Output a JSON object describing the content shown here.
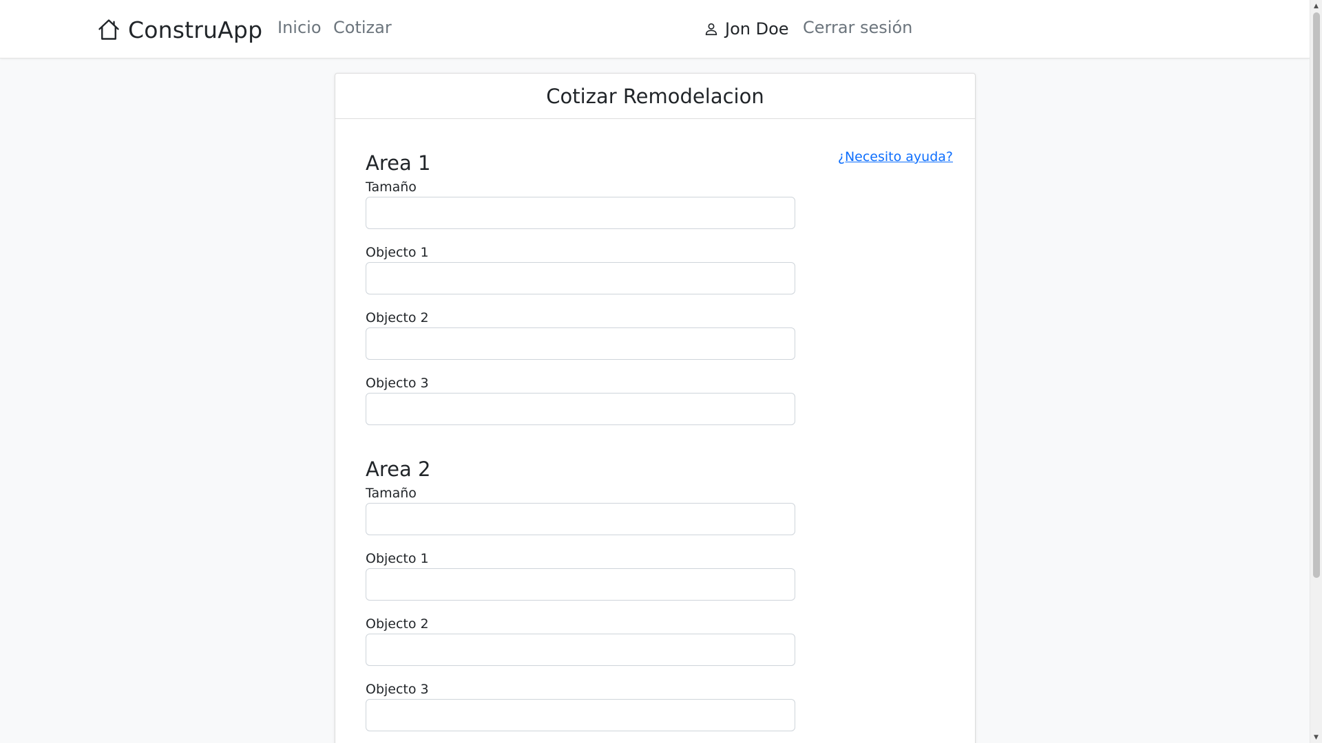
{
  "navbar": {
    "brand": "ConstruApp",
    "brand_icon": "house-icon",
    "links": [
      "Inicio",
      "Cotizar"
    ],
    "user_name": "Jon Doe",
    "user_icon": "person-icon",
    "logout": "Cerrar sesión"
  },
  "card": {
    "title": "Cotizar Remodelacion",
    "help_link": "¿Necesito ayuda?"
  },
  "areas": [
    {
      "title": "Area 1",
      "fields": [
        {
          "label": "Tamaño",
          "value": ""
        },
        {
          "label": "Objecto 1",
          "value": ""
        },
        {
          "label": "Objecto 2",
          "value": ""
        },
        {
          "label": "Objecto 3",
          "value": ""
        }
      ]
    },
    {
      "title": "Area 2",
      "fields": [
        {
          "label": "Tamaño",
          "value": ""
        },
        {
          "label": "Objecto 1",
          "value": ""
        },
        {
          "label": "Objecto 2",
          "value": ""
        },
        {
          "label": "Objecto 3",
          "value": ""
        }
      ]
    }
  ],
  "colors": {
    "link": "#0d6efd",
    "nav_muted": "#6c757d",
    "background": "#f8f9fa"
  }
}
